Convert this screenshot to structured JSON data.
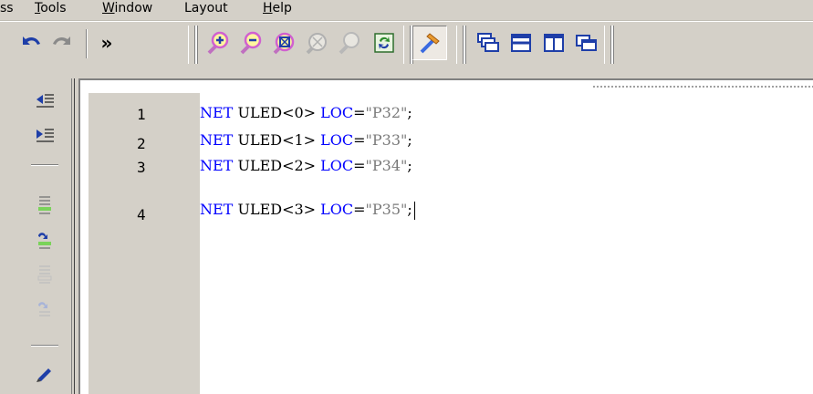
{
  "menubar": {
    "items": [
      {
        "label": "ss",
        "mnemonic": ""
      },
      {
        "label": "Tools",
        "mnemonic": "T"
      },
      {
        "label": "Window",
        "mnemonic": "W"
      },
      {
        "label": "Layout",
        "mnemonic": ""
      },
      {
        "label": "Help",
        "mnemonic": "H"
      }
    ]
  },
  "toolbar": {
    "buttons": [
      {
        "icon": "undo-icon"
      },
      {
        "icon": "redo-icon"
      },
      {
        "icon": "overflow-chevron-icon",
        "label": "»"
      },
      {
        "icon": "zoom-in-icon"
      },
      {
        "icon": "zoom-out-icon"
      },
      {
        "icon": "zoom-full-icon"
      },
      {
        "icon": "zoom-fit-disabled-icon"
      },
      {
        "icon": "zoom-selection-disabled-icon"
      },
      {
        "icon": "refresh-icon"
      },
      {
        "icon": "hammer-icon",
        "pressed": true
      },
      {
        "icon": "cascade-windows-icon"
      },
      {
        "icon": "tile-horizontal-icon"
      },
      {
        "icon": "tile-vertical-icon"
      },
      {
        "icon": "float-window-icon"
      }
    ]
  },
  "leftbar": {
    "buttons": [
      {
        "icon": "outdent-icon"
      },
      {
        "icon": "indent-icon"
      },
      {
        "icon": "toggle-bookmark-icon"
      },
      {
        "icon": "next-bookmark-icon"
      },
      {
        "icon": "previous-bookmark-icon"
      },
      {
        "icon": "clear-bookmarks-icon"
      },
      {
        "icon": "pencil-icon"
      }
    ]
  },
  "editor": {
    "lines": [
      {
        "number": "1",
        "kw": "NET",
        "id": "ULED<0>",
        "attr": "LOC",
        "eq": "=",
        "value": "\"P32\"",
        "end": ";"
      },
      {
        "number": "2",
        "kw": "NET",
        "id": "ULED<1>",
        "attr": "LOC",
        "eq": "=",
        "value": "\"P33\"",
        "end": ";"
      },
      {
        "number": "3",
        "kw": "NET",
        "id": "ULED<2>",
        "attr": "LOC",
        "eq": "=",
        "value": "\"P34\"",
        "end": ";"
      },
      {
        "number": "4",
        "kw": "NET",
        "id": "ULED<3>",
        "attr": "LOC",
        "eq": "=",
        "value": "\"P35\"",
        "end": ";"
      }
    ],
    "colors": {
      "keyword": "#0000ff",
      "identifier": "#000000",
      "string": "#7a7a7a"
    }
  }
}
